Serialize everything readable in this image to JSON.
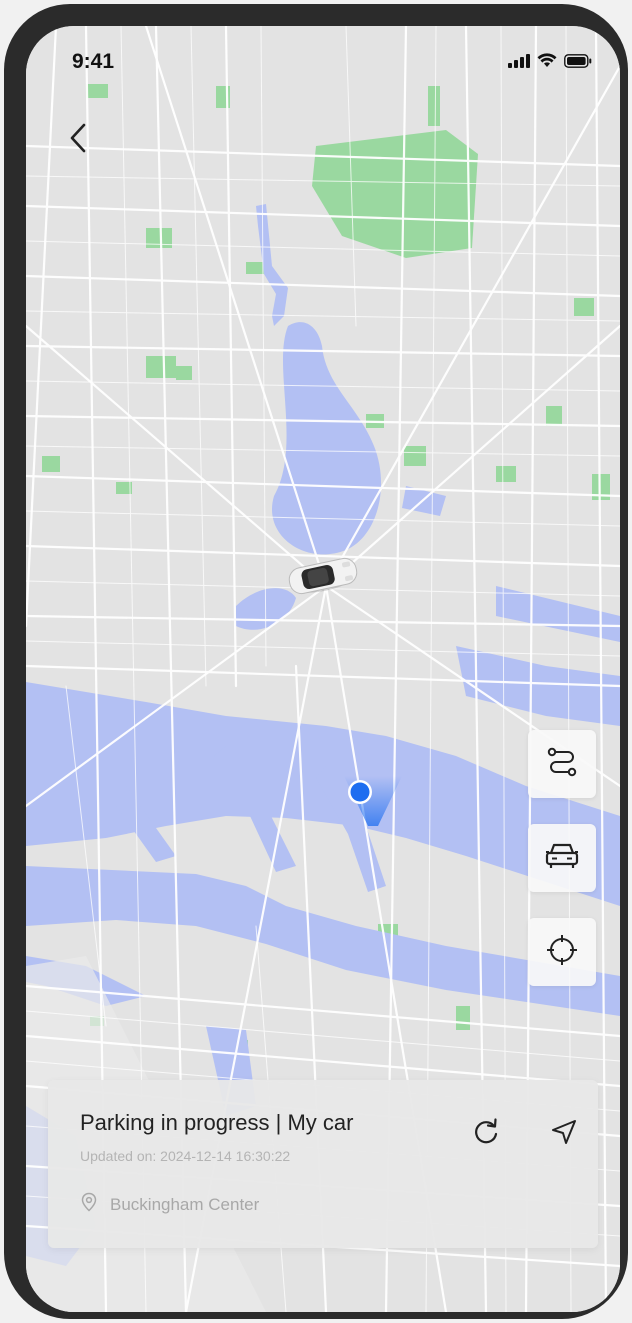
{
  "status_bar": {
    "time": "9:41",
    "icons": [
      "cellular-signal-icon",
      "wifi-icon",
      "battery-icon"
    ]
  },
  "navigation": {
    "back_icon": "chevron-left-icon"
  },
  "map": {
    "colors": {
      "land": "#e3e3e3",
      "water": "#b3c0f3",
      "park": "#9ad8a0",
      "road": "#ffffff",
      "accent": "#1e6ef0"
    }
  },
  "map_controls": [
    {
      "icon": "route-icon"
    },
    {
      "icon": "car-icon"
    },
    {
      "icon": "locate-crosshair-icon"
    }
  ],
  "parking_card": {
    "title": "Parking in progress | My car",
    "updated": "Updated on: 2024-12-14 16:30:22",
    "location": "Buckingham Center",
    "location_icon": "map-pin-icon",
    "refresh_icon": "refresh-icon",
    "navigate_icon": "navigation-arrow-icon"
  }
}
